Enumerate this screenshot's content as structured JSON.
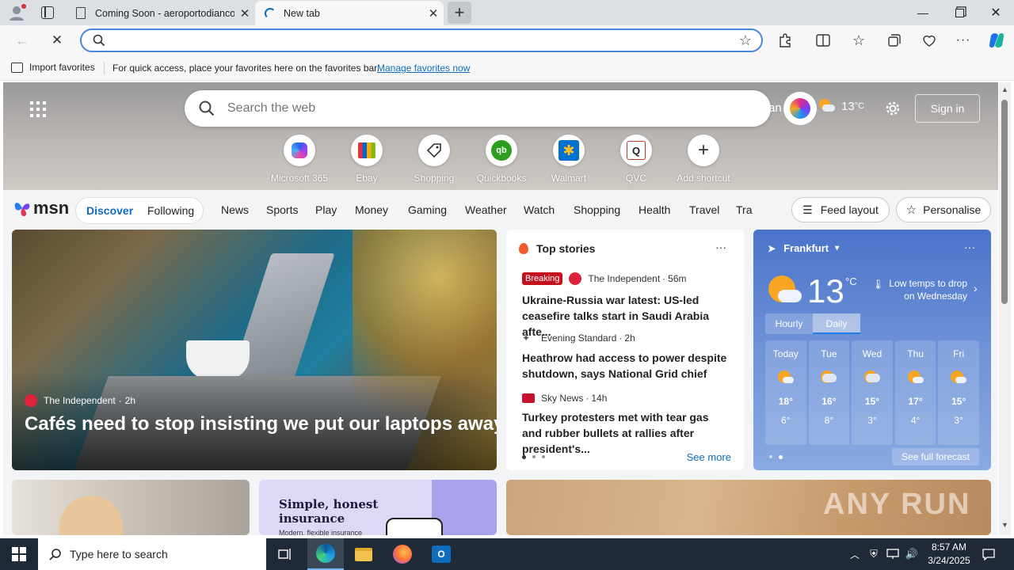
{
  "browser": {
    "tabs": [
      {
        "title": "Coming Soon - aeroportodianco",
        "active": false
      },
      {
        "title": "New tab",
        "active": true
      }
    ],
    "new_tab_icon": "plus-icon",
    "favorites_bar": {
      "import_label": "Import favorites",
      "message": "For quick access, place your favorites here on the favorites bar.",
      "manage_link": "Manage favorites now"
    }
  },
  "newtab": {
    "search_placeholder": "Search the web",
    "partial_text": "an",
    "weather_temp": "13",
    "weather_unit": "°C",
    "sign_in": "Sign in",
    "shortcuts": [
      {
        "label": "Microsoft 365",
        "icon": "microsoft365-icon"
      },
      {
        "label": "Ebay",
        "icon": "ebay-icon"
      },
      {
        "label": "Shopping",
        "icon": "shopping-tag-icon"
      },
      {
        "label": "Quickbooks",
        "icon": "quickbooks-icon"
      },
      {
        "label": "Walmart",
        "icon": "walmart-icon"
      },
      {
        "label": "QVC",
        "icon": "qvc-icon"
      },
      {
        "label": "Add shortcut",
        "icon": "plus-icon"
      }
    ],
    "brand": "msn",
    "pill_tabs": [
      "Discover",
      "Following"
    ],
    "nav": [
      "News",
      "Sports",
      "Play",
      "Money",
      "Gaming",
      "Weather",
      "Watch",
      "Shopping",
      "Health",
      "Travel",
      "Tra"
    ],
    "feed_layout": "Feed layout",
    "personalise": "Personalise"
  },
  "hero_story": {
    "source": "The Independent",
    "time": "2h",
    "headline": "Cafés need to stop insisting we put our laptops away"
  },
  "top_stories": {
    "title": "Top stories",
    "badge": "Breaking",
    "items": [
      {
        "source": "The Independent",
        "time": "56m",
        "headline": "Ukraine-Russia war latest: US-led ceasefire talks start in Saudi Arabia afte..."
      },
      {
        "source": "Evening Standard",
        "time": "2h",
        "headline": "Heathrow had access to power despite shutdown, says National Grid chief"
      },
      {
        "source": "Sky News",
        "time": "14h",
        "headline": "Turkey protesters met with tear gas and rubber bullets at rallies after president's..."
      }
    ],
    "see_more": "See more"
  },
  "weather": {
    "location": "Frankfurt",
    "temp": "13",
    "unit": "°C",
    "alert": "Low temps to drop on Wednesday",
    "toggle": [
      "Hourly",
      "Daily"
    ],
    "days": [
      {
        "day": "Today",
        "high": "18°",
        "low": "6°"
      },
      {
        "day": "Tue",
        "high": "16°",
        "low": "8°"
      },
      {
        "day": "Wed",
        "high": "15°",
        "low": "3°"
      },
      {
        "day": "Thu",
        "high": "17°",
        "low": "4°"
      },
      {
        "day": "Fri",
        "high": "15°",
        "low": "3°"
      }
    ],
    "see_full": "See full forecast"
  },
  "ad": {
    "title": "Simple, honest insurance",
    "subtitle": "Modern, flexible insurance"
  },
  "watermark": "ANY RUN",
  "taskbar": {
    "search_placeholder": "Type here to search",
    "time": "8:57 AM",
    "date": "3/24/2025"
  },
  "colors": {
    "accent": "#0f6cbd",
    "breaking": "#c50f1f",
    "taskbar": "#1f2a36"
  }
}
